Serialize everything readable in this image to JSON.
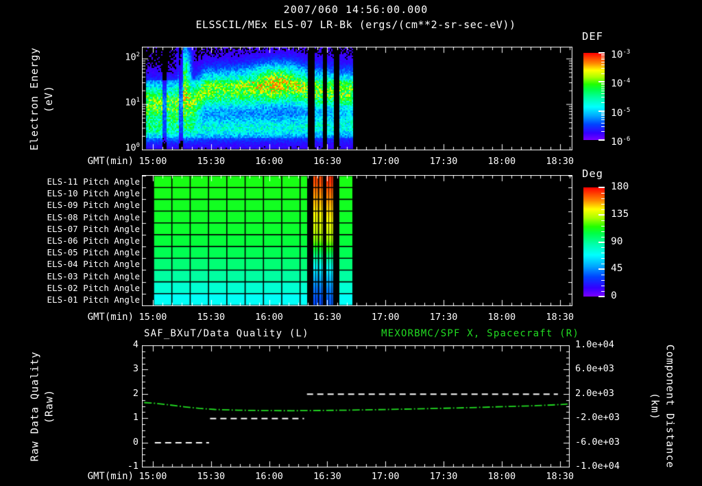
{
  "header": {
    "title": "2007/060 14:56:00.000",
    "subtitle": "ELSSCIL/MEx ELS-07 LR-Bk  (ergs/(cm**2-sr-sec-eV))"
  },
  "colors": {
    "background": "#000000",
    "text": "#ffffff",
    "frame": "#ffffff",
    "series_green": "#22dd22",
    "colormap_stops": [
      [
        0,
        "#7a00ff"
      ],
      [
        0.08,
        "#3300ff"
      ],
      [
        0.18,
        "#0044ff"
      ],
      [
        0.28,
        "#00aaff"
      ],
      [
        0.38,
        "#00ffff"
      ],
      [
        0.48,
        "#00ffaa"
      ],
      [
        0.58,
        "#00ff44"
      ],
      [
        0.64,
        "#22ff00"
      ],
      [
        0.72,
        "#aaff00"
      ],
      [
        0.8,
        "#ffff00"
      ],
      [
        0.88,
        "#ff8800"
      ],
      [
        1,
        "#ff0000"
      ]
    ]
  },
  "time_axis": {
    "label": "GMT(min)",
    "ticks": [
      "15:00",
      "15:30",
      "16:00",
      "16:30",
      "17:00",
      "17:30",
      "18:00",
      "18:30"
    ],
    "tick_interval_min": 30,
    "minor_tick_interval_min": 5
  },
  "chart_data": [
    {
      "id": "electron-energy-spectrogram",
      "type": "heatmap",
      "instrument": "ELSSCIL/MEx ELS-07 LR-Bk",
      "units": "ergs/(cm**2-sr-sec-eV)",
      "xlabel": "GMT(min)",
      "x_ticks": [
        "15:00",
        "15:30",
        "16:00",
        "16:30",
        "17:00",
        "17:30",
        "18:00",
        "18:30"
      ],
      "ylabel_line1": "Electron Energy",
      "ylabel_line2": "(eV)",
      "y_scale": "log",
      "y_tick_labels": [
        "10^2",
        "10^1",
        "10^0"
      ],
      "y_range_ev": [
        1,
        180
      ],
      "data_start": "14:56",
      "data_end": "16:42",
      "colorbar": {
        "label": "DEF",
        "tick_labels": [
          "10^-3",
          "10^-4",
          "10^-5",
          "10^-6"
        ],
        "log10_range": [
          -6,
          -3
        ]
      },
      "bands": [
        {
          "name": "main-band",
          "amp": 0.5,
          "sigma": 0.3,
          "center_log_ev": [
            [
              -4.2,
              1.0
            ],
            [
              20,
              1.0
            ],
            [
              26,
              1.32
            ],
            [
              55,
              1.38
            ],
            [
              70,
              1.42
            ],
            [
              85,
              1.32
            ],
            [
              103,
              1.28
            ]
          ]
        },
        {
          "name": "low-band",
          "amp": 0.27,
          "sigma": 0.17,
          "center_log_ev": [
            [
              -4.2,
              0.45
            ],
            [
              103,
              0.52
            ]
          ]
        }
      ],
      "hotspots": [
        {
          "name": "flare-1516",
          "t": 16.5,
          "t_sigma": 2,
          "log_ev": 1.7,
          "e_sigma": 0.4,
          "amp": 0.45
        },
        {
          "name": "enhancement-1605",
          "t": 63,
          "t_sigma": 8,
          "log_ev": 1.6,
          "e_sigma": 0.22,
          "amp": 0.24
        }
      ],
      "data_gaps_min": [
        [
          79.6,
          82.8
        ],
        [
          87.7,
          89.5
        ],
        [
          93.0,
          96.2
        ]
      ],
      "dim_intervals_min": [
        [
          4.5,
          6.5
        ],
        [
          12.8,
          15.2
        ]
      ],
      "t_range_min": [
        -4.2,
        102.9
      ]
    },
    {
      "id": "pitch-angle-heatmap",
      "type": "heatmap",
      "rows": [
        "ELS-11 Pitch Angle",
        "ELS-10 Pitch Angle",
        "ELS-09 Pitch Angle",
        "ELS-08 Pitch Angle",
        "ELS-07 Pitch Angle",
        "ELS-06 Pitch Angle",
        "ELS-05 Pitch Angle",
        "ELS-04 Pitch Angle",
        "ELS-03 Pitch Angle",
        "ELS-02 Pitch Angle",
        "ELS-01 Pitch Angle"
      ],
      "xlabel": "GMT(min)",
      "x_ticks": [
        "15:00",
        "15:30",
        "16:00",
        "16:30",
        "17:00",
        "17:30",
        "18:00",
        "18:30"
      ],
      "colorbar": {
        "label": "Deg",
        "tick_labels": [
          "180",
          "135",
          "90",
          "45",
          "0"
        ],
        "range_deg": [
          0,
          180
        ]
      },
      "baseline_deg": [
        112,
        111,
        110,
        109,
        108,
        106,
        102,
        96,
        88,
        78,
        70
      ],
      "event_columns": [
        {
          "t_range_min": [
            82.8,
            87.7
          ],
          "deg": [
            168,
            158,
            150,
            142,
            136,
            124,
            100,
            72,
            55,
            42,
            34
          ]
        },
        {
          "t_range_min": [
            89.5,
            93.0
          ],
          "deg": [
            172,
            162,
            152,
            145,
            138,
            127,
            104,
            76,
            58,
            45,
            37
          ]
        }
      ],
      "data_gaps_min": [
        [
          79.6,
          82.8
        ],
        [
          87.7,
          89.5
        ],
        [
          93.0,
          96.2
        ]
      ],
      "t_range_min": [
        0.35,
        102.9
      ],
      "grid_interval_min": 9.45
    },
    {
      "id": "quality-and-spacecraft-distance",
      "type": "line",
      "title_left": "SAF_BXuT/Data Quality (L)",
      "title_right": "MEXORBMC/SPF X, Spacecraft (R)",
      "xlabel": "GMT(min)",
      "x_ticks": [
        "15:00",
        "15:30",
        "16:00",
        "16:30",
        "17:00",
        "17:30",
        "18:00",
        "18:30"
      ],
      "left_axis": {
        "label_line1": "Raw Data Quality",
        "label_line2": "(Raw)",
        "tick_labels": [
          "4",
          "3",
          "2",
          "1",
          "0",
          "-1"
        ],
        "range": [
          -1,
          4
        ]
      },
      "right_axis": {
        "label_line1": "Component Distance",
        "label_line2": "(km)",
        "tick_labels": [
          "1.0e+04",
          "6.0e+03",
          "2.0e+03",
          "-2.0e+03",
          "-6.0e+03",
          "-1.0e+04"
        ],
        "range_km": [
          -10000,
          10000
        ]
      },
      "series": [
        {
          "name": "SAF_BXuT/Data Quality",
          "axis": "left",
          "style": "dashed-white",
          "steps": [
            {
              "value": 0,
              "t_range_min": [
                1,
                29
              ]
            },
            {
              "value": 1,
              "t_range_min": [
                29.5,
                78
              ]
            },
            {
              "value": 2,
              "t_range_min": [
                79.5,
                209
              ]
            }
          ]
        },
        {
          "name": "MEXORBMC/SPF X Spacecraft",
          "axis": "right",
          "style": "dashed-green",
          "points_t_km": [
            [
              -4.5,
              620
            ],
            [
              0,
              550
            ],
            [
              8,
              260
            ],
            [
              16,
              -60
            ],
            [
              24,
              -330
            ],
            [
              32,
              -510
            ],
            [
              44,
              -630
            ],
            [
              58,
              -700
            ],
            [
              72,
              -710
            ],
            [
              86,
              -680
            ],
            [
              100,
              -625
            ],
            [
              114,
              -550
            ],
            [
              128,
              -465
            ],
            [
              142,
              -370
            ],
            [
              156,
              -265
            ],
            [
              170,
              -150
            ],
            [
              184,
              -20
            ],
            [
              198,
              120
            ],
            [
              208,
              260
            ],
            [
              214,
              380
            ]
          ]
        }
      ]
    }
  ]
}
